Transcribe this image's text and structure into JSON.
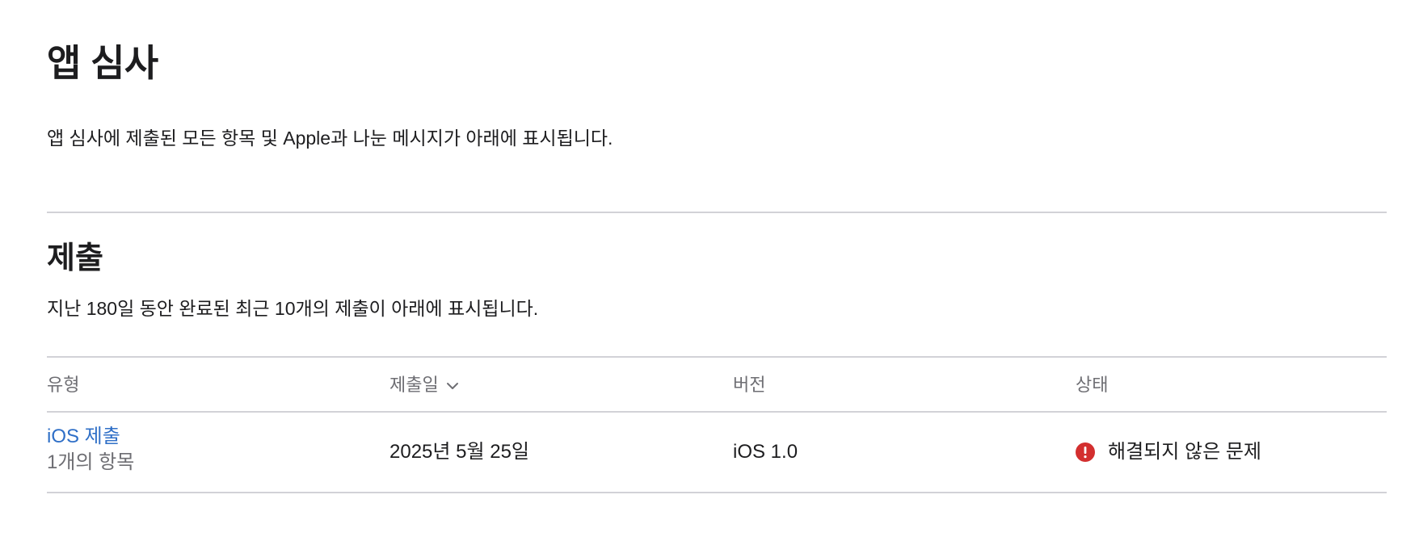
{
  "header": {
    "title": "앱 심사",
    "description": "앱 심사에 제출된 모든 항목 및 Apple과 나눈 메시지가 아래에 표시됩니다."
  },
  "submissions": {
    "title": "제출",
    "description": "지난 180일 동안 완료된 최근 10개의 제출이 아래에 표시됩니다.",
    "columns": {
      "type": "유형",
      "date": "제출일",
      "version": "버전",
      "status": "상태"
    },
    "sort_icon": "chevron-down-icon",
    "rows": [
      {
        "type": "iOS 제출",
        "items": "1개의 항목",
        "date": "2025년 5월 25일",
        "version": "iOS 1.0",
        "status": "해결되지 않은 문제",
        "status_icon": "error-icon",
        "status_color": "#d32f2f"
      }
    ]
  },
  "colors": {
    "link": "#2f6fc7",
    "divider": "#d2d2d7",
    "muted": "#6e6e73",
    "text": "#1d1d1f"
  }
}
